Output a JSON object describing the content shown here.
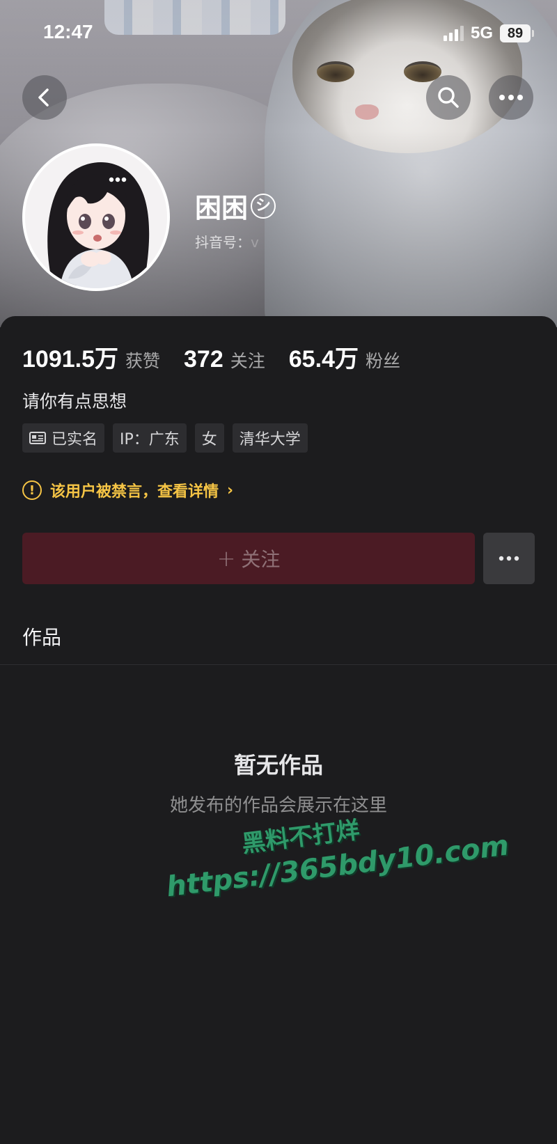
{
  "status_bar": {
    "time": "12:47",
    "network": "5G",
    "battery": "89"
  },
  "nav": {
    "back_icon": "chevron-left-icon",
    "search_icon": "search-icon",
    "more_icon": "more-horizontal-icon"
  },
  "profile": {
    "nickname": "困困",
    "nickname_badge": "シ",
    "douyin_id_label": "抖音号：",
    "douyin_id_value": "v"
  },
  "stats": [
    {
      "value": "1091.5万",
      "label": "获赞"
    },
    {
      "value": "372",
      "label": "关注"
    },
    {
      "value": "65.4万",
      "label": "粉丝"
    }
  ],
  "bio": "请你有点思想",
  "tags": [
    {
      "label": "已实名",
      "icon": "id-card-icon"
    },
    {
      "label": "IP：广东"
    },
    {
      "label": "女"
    },
    {
      "label": "清华大学"
    }
  ],
  "notice": {
    "icon_glyph": "!",
    "text": "该用户被禁言，查看详情",
    "chevron": "›",
    "color": "#f5c445"
  },
  "actions": {
    "follow_plus": "+",
    "follow_label": "关注",
    "more_label": "···"
  },
  "tabs": {
    "works": "作品"
  },
  "empty_state": {
    "title": "暂无作品",
    "subtitle": "她发布的作品会展示在这里"
  },
  "watermark": {
    "line1": "黑料不打烊",
    "line2": "https://365bdy10.com"
  },
  "colors": {
    "background": "#1c1c1e",
    "follow_button": "#4b1b24",
    "warning": "#f5c445",
    "watermark": "#2f9a6a"
  }
}
